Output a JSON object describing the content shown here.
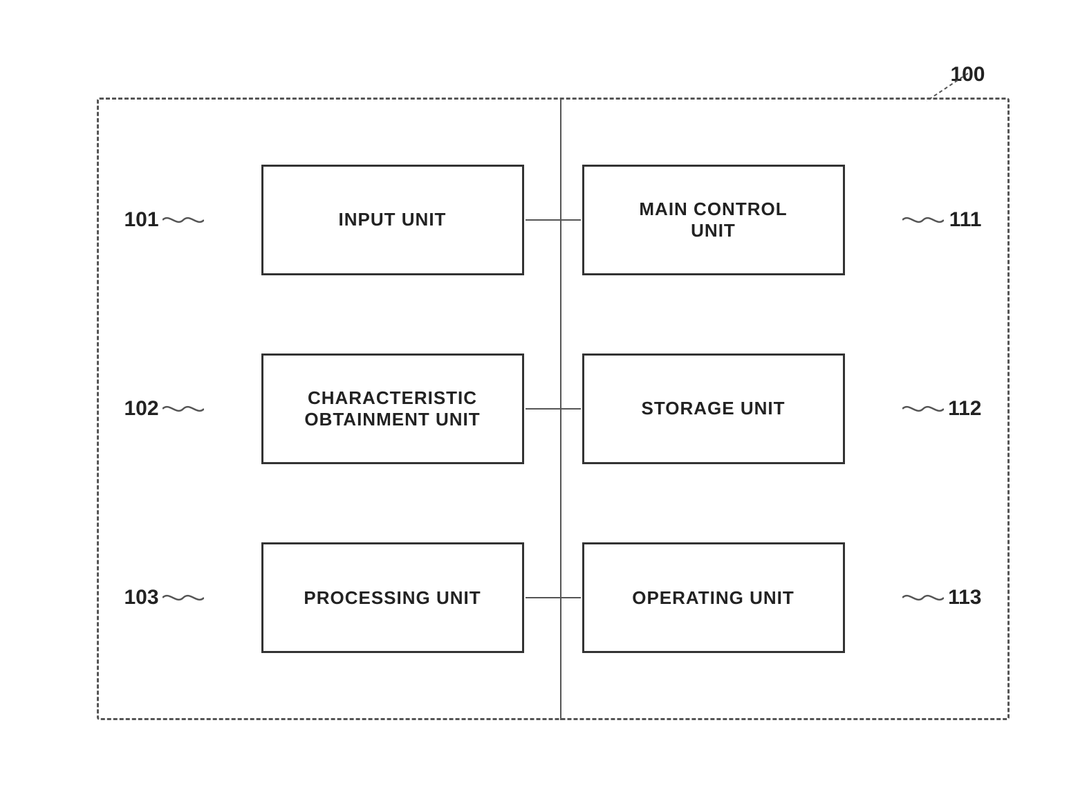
{
  "diagram": {
    "main_ref": "100",
    "blocks": {
      "input_unit": "INPUT UNIT",
      "main_control_unit": "MAIN CONTROL\nUNIT",
      "characteristic_obtainment_unit": "CHARACTERISTIC\nOBTAINMENT UNIT",
      "storage_unit": "STORAGE UNIT",
      "processing_unit": "PROCESSING UNIT",
      "operating_unit": "OPERATING UNIT"
    },
    "ref_numbers": {
      "r101": "101",
      "r102": "102",
      "r103": "103",
      "r111": "111",
      "r112": "112",
      "r113": "113"
    }
  }
}
